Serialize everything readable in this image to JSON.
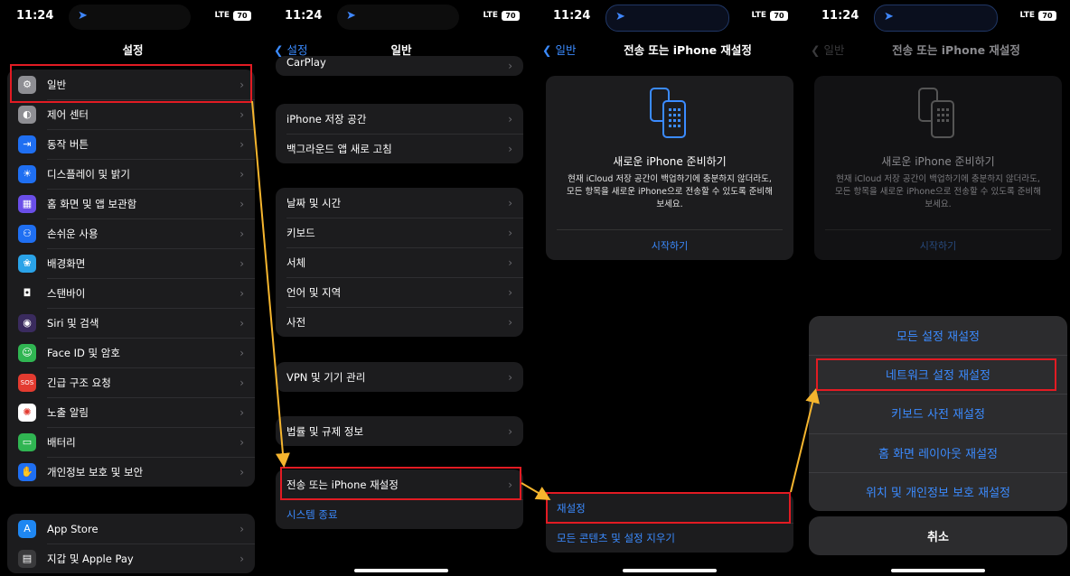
{
  "status": {
    "time": "11:24",
    "signal": "LTE",
    "battery": "70"
  },
  "panel1": {
    "title": "설정",
    "items": [
      {
        "label": "일반",
        "icon": "gear-icon",
        "color": "#8e8e93",
        "glyph": "⚙"
      },
      {
        "label": "제어 센터",
        "icon": "toggles-icon",
        "color": "#8e8e93",
        "glyph": "◐"
      },
      {
        "label": "동작 버튼",
        "icon": "action-button-icon",
        "color": "#1f6ff2",
        "glyph": "⇥"
      },
      {
        "label": "디스플레이 및 밝기",
        "icon": "sun-icon",
        "color": "#1f6ff2",
        "glyph": "☀"
      },
      {
        "label": "홈 화면 및 앱 보관함",
        "icon": "home-grid-icon",
        "color": "#6a4ee8",
        "glyph": "▦"
      },
      {
        "label": "손쉬운 사용",
        "icon": "accessibility-icon",
        "color": "#1f6ff2",
        "glyph": "⚇"
      },
      {
        "label": "배경화면",
        "icon": "wallpaper-icon",
        "color": "#2aa3e8",
        "glyph": "❀"
      },
      {
        "label": "스탠바이",
        "icon": "standby-icon",
        "color": "#1c1c1e",
        "glyph": "◘"
      },
      {
        "label": "Siri 및 검색",
        "icon": "siri-icon",
        "color": "#3a2b5e",
        "glyph": "◉"
      },
      {
        "label": "Face ID 및 암호",
        "icon": "faceid-icon",
        "color": "#30b552",
        "glyph": "☺"
      },
      {
        "label": "긴급 구조 요청",
        "icon": "sos-icon",
        "color": "#e33b30",
        "glyph": "SOS"
      },
      {
        "label": "노출 알림",
        "icon": "exposure-icon",
        "color": "#ffffff",
        "glyph": "✺"
      },
      {
        "label": "배터리",
        "icon": "battery-icon",
        "color": "#30b552",
        "glyph": "▭"
      },
      {
        "label": "개인정보 보호 및 보안",
        "icon": "hand-icon",
        "color": "#1f6ff2",
        "glyph": "✋"
      }
    ],
    "items2": [
      {
        "label": "App Store",
        "icon": "appstore-icon",
        "color": "#1f87f2",
        "glyph": "A"
      },
      {
        "label": "지갑 및 Apple Pay",
        "icon": "wallet-icon",
        "color": "#3a3a3c",
        "glyph": "▤"
      }
    ]
  },
  "panel2": {
    "back": "설정",
    "title": "일반",
    "carplay": "CarPlay",
    "group1": [
      "iPhone 저장 공간",
      "백그라운드 앱 새로 고침"
    ],
    "group2": [
      "날짜 및 시간",
      "키보드",
      "서체",
      "언어 및 지역",
      "사전"
    ],
    "group3": [
      "VPN 및 기기 관리"
    ],
    "group4": [
      "법률 및 규제 정보"
    ],
    "transfer": "전송 또는 iPhone 재설정",
    "shutdown": "시스템 종료"
  },
  "panel3": {
    "back": "일반",
    "title": "전송 또는 iPhone 재설정",
    "card_title": "새로운 iPhone 준비하기",
    "card_desc": "현재 iCloud 저장 공간이 백업하기에 충분하지 않더라도, 모든 항목을 새로운 iPhone으로 전송할 수 있도록 준비해 보세요.",
    "card_start": "시작하기",
    "reset": "재설정",
    "erase": "모든 콘텐츠 및 설정 지우기"
  },
  "panel4": {
    "back": "일반",
    "title": "전송 또는 iPhone 재설정",
    "card_title": "새로운 iPhone 준비하기",
    "card_desc": "현재 iCloud 저장 공간이 백업하기에 충분하지 않더라도, 모든 항목을 새로운 iPhone으로 전송할 수 있도록 준비해 보세요.",
    "card_start": "시작하기",
    "options": [
      "모든 설정 재설정",
      "네트워크 설정 재설정",
      "키보드 사전 재설정",
      "홈 화면 레이아웃 재설정",
      "위치 및 개인정보 보호 재설정"
    ],
    "cancel": "취소"
  },
  "colors": {
    "accent": "#3b8bff",
    "highlight": "#e21b23",
    "arrow": "#f5b52e"
  }
}
